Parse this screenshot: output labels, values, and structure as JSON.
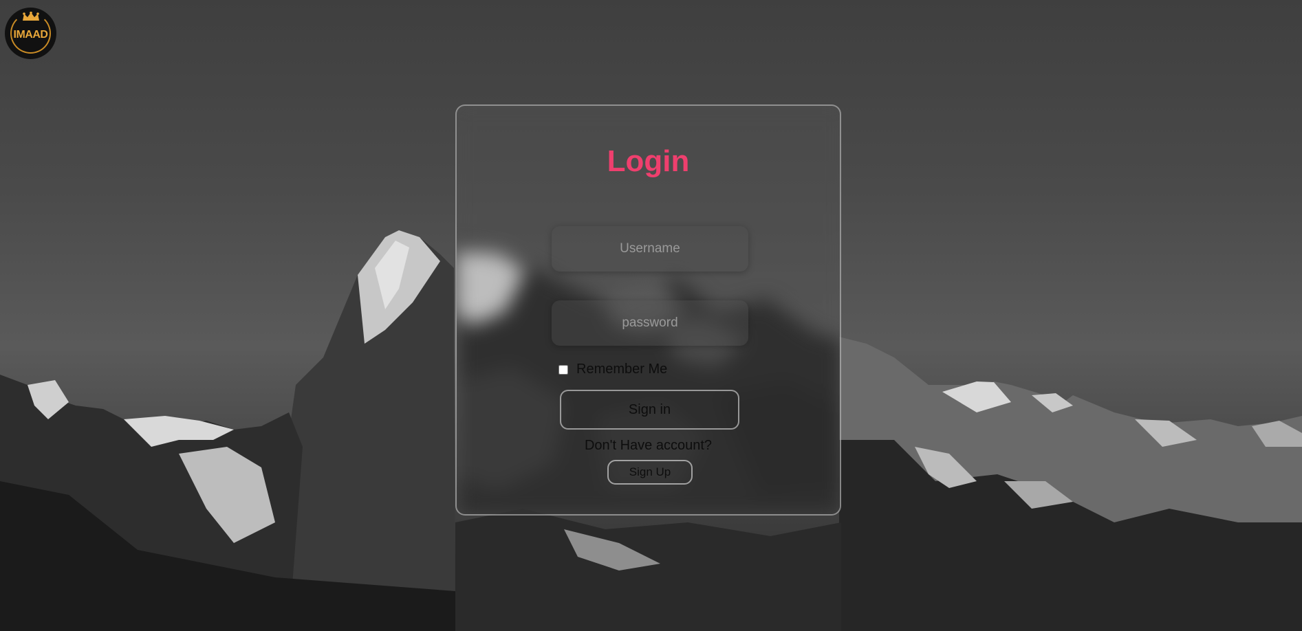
{
  "logo": {
    "text": "IMAAD",
    "icon": "crown-icon",
    "color": "#e8a73a"
  },
  "form": {
    "title": "Login",
    "title_color": "#ef3f6e",
    "username_placeholder": "Username",
    "password_placeholder": "password",
    "remember_label": "Remember Me",
    "remember_checked": false,
    "signin_label": "Sign in",
    "no_account_text": "Don't Have account?",
    "signup_label": "Sign Up"
  }
}
